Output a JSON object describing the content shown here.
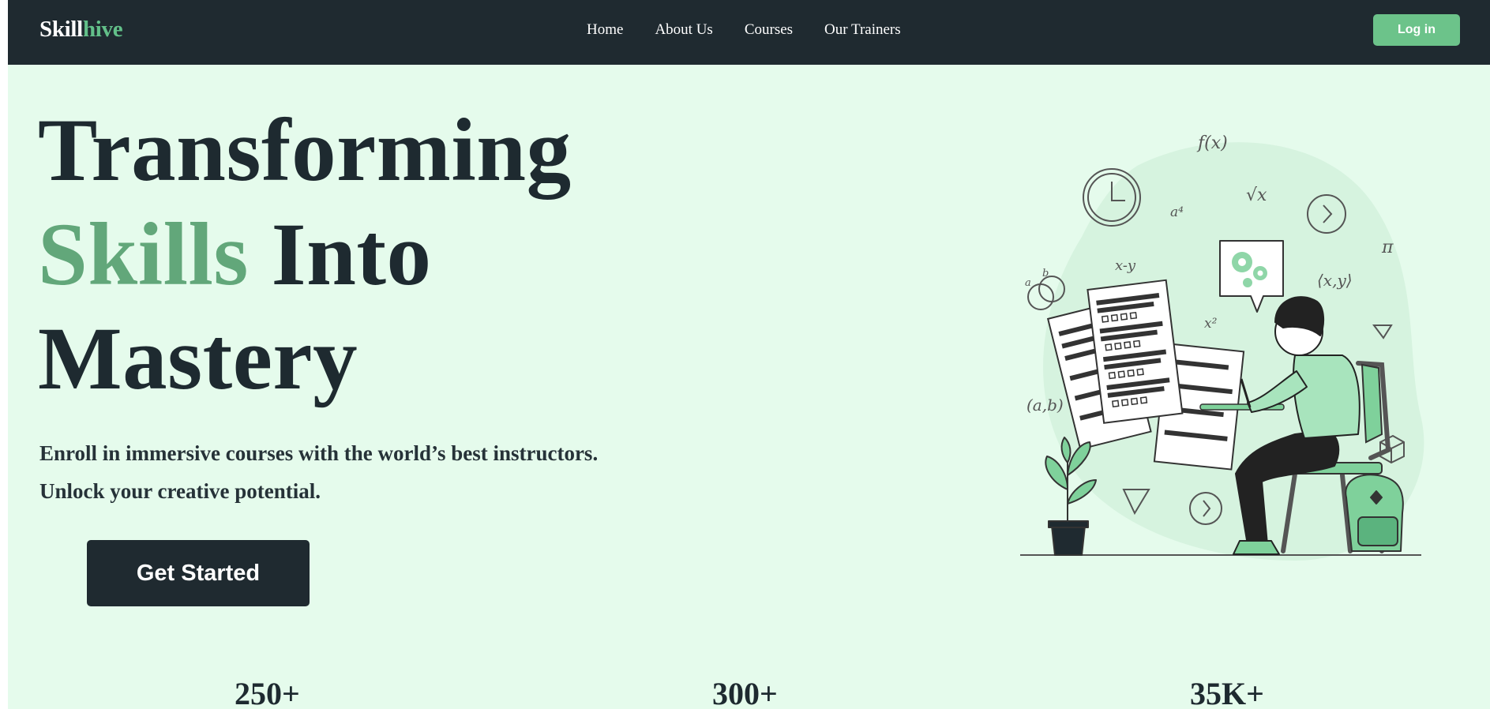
{
  "brand": {
    "name_main": "Skill",
    "name_accent": "hive"
  },
  "nav": {
    "links": [
      "Home",
      "About Us",
      "Courses",
      "Our Trainers"
    ],
    "login_label": "Log in"
  },
  "hero": {
    "line1": "Transforming",
    "line2_accent": "Skills",
    "line2_rest": " Into",
    "line3": "Mastery",
    "subtitle_line1": "Enroll in immersive courses with the world’s best instructors.",
    "subtitle_line2": "Unlock your creative potential.",
    "cta_label": "Get Started"
  },
  "stats": [
    "250+",
    "300+",
    "35K+"
  ],
  "illustration": {
    "labels": [
      "f(x)",
      "a⁴",
      "√x",
      "x-y",
      "x²",
      "π",
      "⟨x,y⟩",
      "a",
      "b",
      "(a,b)"
    ]
  },
  "colors": {
    "nav_bg": "#1f2a30",
    "page_bg": "#e5fbec",
    "accent": "#62c089",
    "dark_text": "#1e2a30",
    "button_dark": "#1f2a30",
    "login_green": "#6cc38a"
  }
}
